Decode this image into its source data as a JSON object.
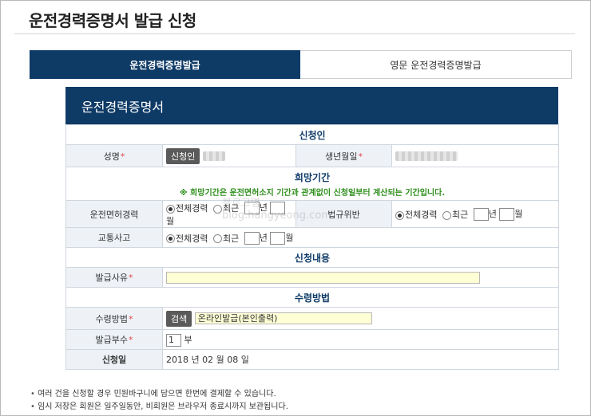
{
  "page": {
    "title": "운전경력증명서 발급 신청"
  },
  "tabs": [
    {
      "label": "운전경력증명발급",
      "active": true
    },
    {
      "label": "영문 운전경력증명발급",
      "active": false
    }
  ],
  "form": {
    "header": "운전경력증명서",
    "applicant": {
      "section_title": "신청인",
      "name_label": "성명",
      "name_button": "신청인",
      "birth_label": "생년월일"
    },
    "period": {
      "section_title": "희망기간",
      "note": "※ 희망기간은 운전면허소지 기간과 관계없이 신청일부터 계산되는 기간입니다.",
      "rows": [
        {
          "label": "운전면허경력",
          "all": "전체경력",
          "recent": "최근",
          "year": "년",
          "month": "월"
        },
        {
          "label": "교통사고",
          "all": "전체경력",
          "recent": "최근",
          "year": "년",
          "month": "월"
        }
      ],
      "violation": {
        "label": "법규위반",
        "all": "전체경력",
        "recent": "최근",
        "year": "년",
        "month": "월"
      }
    },
    "content": {
      "section_title": "신청내용",
      "reason_label": "발급사유"
    },
    "receipt": {
      "section_title": "수령방법",
      "method_label": "수령방법",
      "search_button": "검색",
      "method_value": "온라인발급(본인출력)",
      "copies_label": "발급부수",
      "copies_value": "1",
      "copies_unit": "부",
      "date_label": "신청일",
      "date_value": "2018 년 02 월 08 일"
    }
  },
  "watermark": {
    "line1": "블로그명",
    "line2": "blog.hangyeong.com"
  },
  "notes": [
    "여러 건을 신청할 경우 민원바구니에 담으면 한번에 결제할 수 있습니다.",
    "임시 저장은 회원은 일주일동안, 비회원은 브라우저 종료시까지 보관됩니다."
  ],
  "colors": {
    "primary": "#0e3a66",
    "required": "#e04a4a",
    "note": "#2f8f1c",
    "input_bg": "#ffffd6"
  }
}
